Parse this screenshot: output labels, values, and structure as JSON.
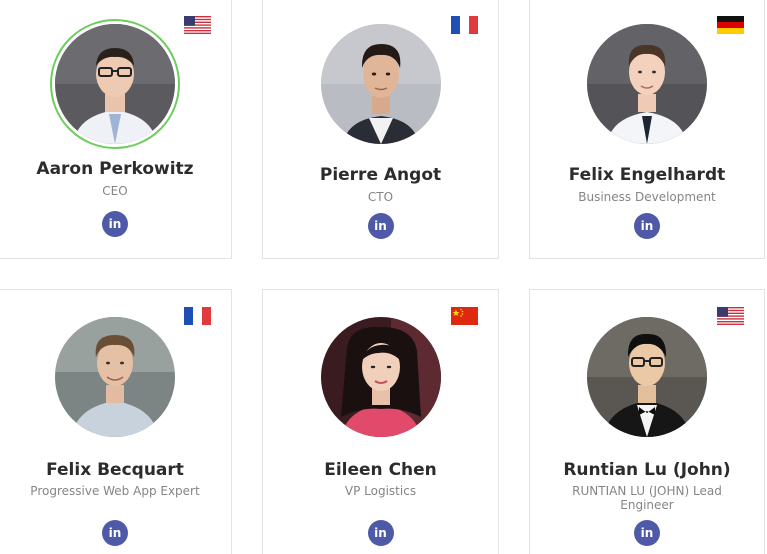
{
  "colors": {
    "linkedin": "#4e5aa7",
    "highlight_ring": "#6ccd5c",
    "card_border": "#e3e3e3"
  },
  "members": [
    {
      "name": "Aaron Perkowitz",
      "role": "CEO",
      "flag": "us-flag-icon",
      "linkedin_label": "in"
    },
    {
      "name": "Pierre Angot",
      "role": "CTO",
      "flag": "fr-flag-icon",
      "linkedin_label": "in"
    },
    {
      "name": "Felix Engelhardt",
      "role": "Business Development",
      "flag": "de-flag-icon",
      "linkedin_label": "in"
    },
    {
      "name": "Felix Becquart",
      "role": "Progressive Web App Expert",
      "flag": "fr-flag-icon",
      "linkedin_label": "in"
    },
    {
      "name": "Eileen Chen",
      "role": "VP Logistics",
      "flag": "cn-flag-icon",
      "linkedin_label": "in"
    },
    {
      "name": "Runtian Lu (John)",
      "role": "RUNTIAN LU (JOHN) Lead Engineer",
      "flag": "us-flag-icon",
      "linkedin_label": "in"
    }
  ]
}
